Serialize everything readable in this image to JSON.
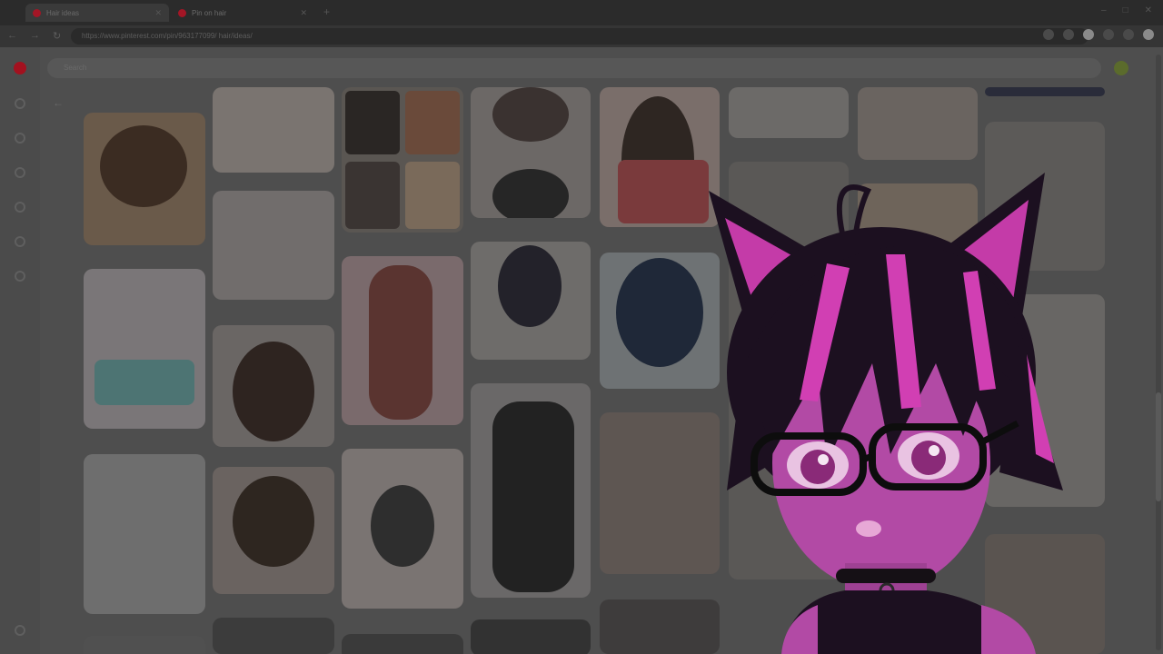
{
  "browser": {
    "tabs": [
      {
        "title": "Hair ideas",
        "active": true
      },
      {
        "title": "Pin on hair",
        "active": false
      }
    ],
    "new_tab_glyph": "+",
    "window_buttons": [
      "–",
      "□",
      "✕"
    ],
    "nav_glyphs": [
      "←",
      "→",
      "↻"
    ],
    "url": "https://www.pinterest.com/pin/963177099/ hair/ideas/"
  },
  "pinterest": {
    "search_placeholder": "Search",
    "back_glyph": "←",
    "sidebar_icons": [
      "home-icon",
      "explore-icon",
      "create-icon",
      "notifications-icon",
      "messages-icon",
      "updates-icon",
      "settings-icon"
    ],
    "brand_color": "#a3111f"
  },
  "overlay": {
    "description": "vtuber-avatar",
    "accent_color": "#d13fb3",
    "hair_color": "#1c1020"
  }
}
